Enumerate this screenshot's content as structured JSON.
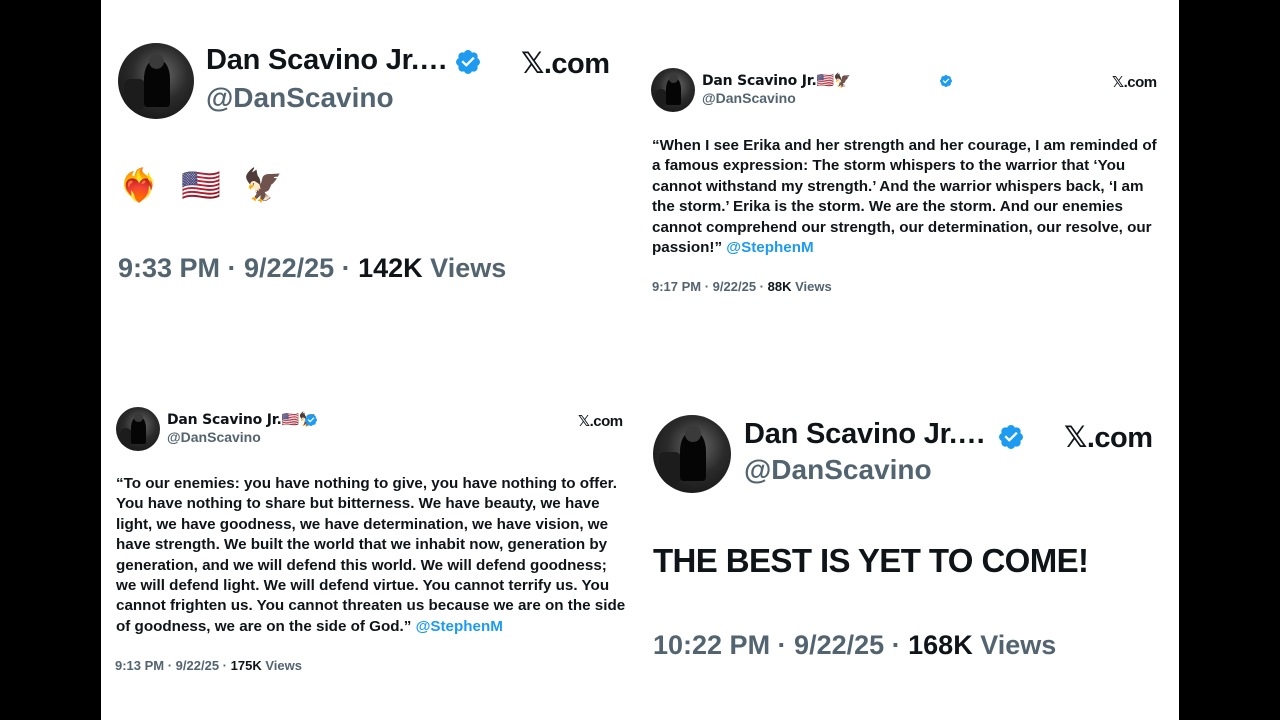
{
  "colors": {
    "text": "#0f1419",
    "secondary": "#536471",
    "link": "#1d9bf0",
    "verified": "#1d9bf0",
    "letterbox": "#000000"
  },
  "icons": {
    "verified": "verified-badge-icon",
    "x_logo": "x-logo-icon"
  },
  "tweets": [
    {
      "name": "Dan Scavino Jr.…",
      "handle": "@DanScavino",
      "site": ".com",
      "site_mark": "𝕏",
      "text": "❤️‍🔥 🇺🇸 🦅",
      "time": "9:33 PM · 9/22/25 · ",
      "views_count": "142K",
      "views_label": " Views"
    },
    {
      "name": "Dan Scavino Jr.🇺🇸🦅",
      "handle": "@DanScavino",
      "site": ".com",
      "site_mark": "𝕏",
      "text": "“When I see Erika and her strength and her courage, I am reminded of a famous expression: The storm whispers to the warrior that ‘You cannot withstand my strength.’ And the warrior whispers back, ‘I am the storm.’ Erika is the storm. We are the storm. And our enemies cannot comprehend our strength, our determination, our resolve, our passion!” ",
      "mention": "@StephenM",
      "time": "9:17 PM · 9/22/25 · ",
      "views_count": "88K",
      "views_label": " Views"
    },
    {
      "name": "Dan Scavino Jr.🇺🇸🦅",
      "handle": "@DanScavino",
      "site": ".com",
      "site_mark": "𝕏",
      "text": "“To our enemies: you have nothing to give, you have nothing to offer. You have nothing to share but bitterness. We have beauty, we have light, we have goodness, we have determination, we have vision, we have strength. We built the world that we inhabit now, generation by generation, and we will defend this world. We will defend goodness; we will defend light. We will defend virtue. You cannot terrify us. You cannot frighten us. You cannot threaten us because we are on the side of goodness, we are on the side of God.” ",
      "mention": "@StephenM",
      "time": "9:13 PM · 9/22/25 · ",
      "views_count": "175K",
      "views_label": " Views"
    },
    {
      "name": "Dan Scavino Jr.…",
      "handle": "@DanScavino",
      "site": ".com",
      "site_mark": "𝕏",
      "text": "THE BEST IS YET TO COME!",
      "time": "10:22 PM · 9/22/25 · ",
      "views_count": "168K",
      "views_label": " Views"
    }
  ]
}
